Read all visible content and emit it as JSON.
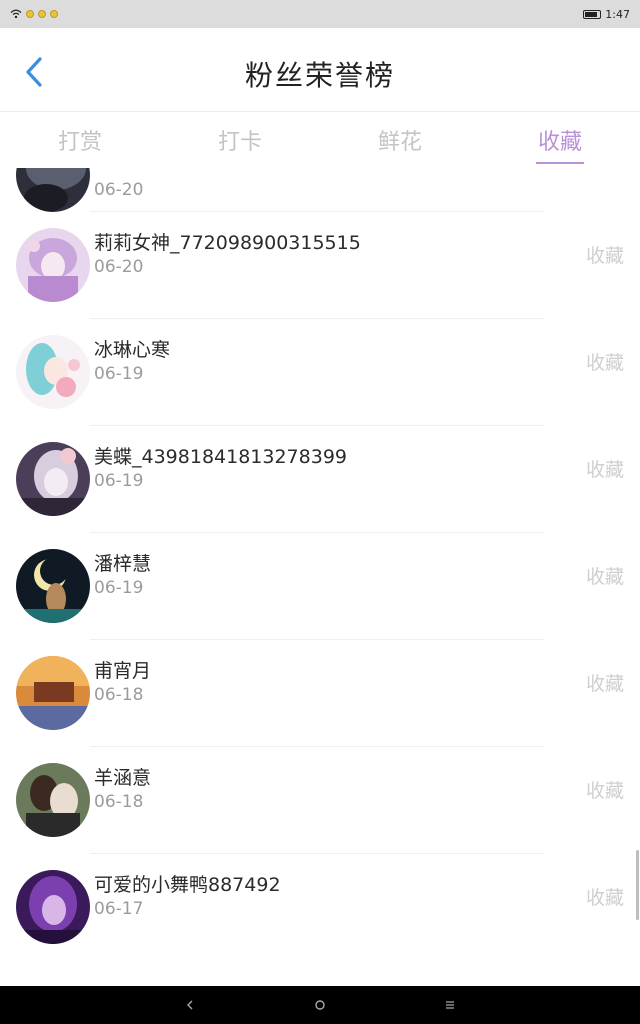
{
  "status_bar": {
    "time": "1:47"
  },
  "header": {
    "title": "粉丝荣誉榜"
  },
  "tabs": [
    {
      "label": "打赏",
      "active": false
    },
    {
      "label": "打卡",
      "active": false
    },
    {
      "label": "鲜花",
      "active": false
    },
    {
      "label": "收藏",
      "active": true
    }
  ],
  "colors": {
    "accent": "#b892d8",
    "back_arrow": "#3b8de0",
    "inactive_text": "#c4c4c4"
  },
  "list": {
    "partial_top": {
      "date": "06-20"
    },
    "items": [
      {
        "name": "莉莉女神_772098900315515",
        "date": "06-20",
        "action": "收藏"
      },
      {
        "name": "冰琳心寒",
        "date": "06-19",
        "action": "收藏"
      },
      {
        "name": "美蝶_43981841813278399",
        "date": "06-19",
        "action": "收藏"
      },
      {
        "name": "潘梓慧",
        "date": "06-19",
        "action": "收藏"
      },
      {
        "name": "甫宵月",
        "date": "06-18",
        "action": "收藏"
      },
      {
        "name": "羊涵意",
        "date": "06-18",
        "action": "收藏"
      },
      {
        "name": "可爱的小舞鸭887492",
        "date": "06-17",
        "action": "收藏"
      }
    ]
  },
  "nav_bar": {
    "back_icon": "back-icon",
    "home_icon": "home-icon",
    "menu_icon": "menu-icon"
  }
}
